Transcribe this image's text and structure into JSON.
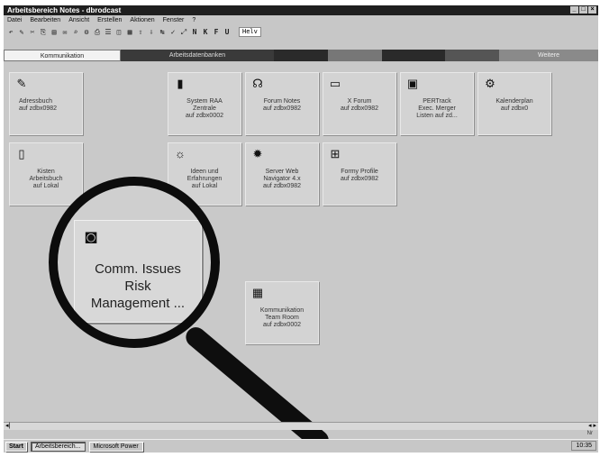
{
  "window": {
    "title": "Arbeitsbereich Notes - dbrodcast",
    "controls": [
      "_",
      "□",
      "×"
    ]
  },
  "menu": [
    "Datei",
    "Bearbeiten",
    "Ansicht",
    "Erstellen",
    "Aktionen",
    "Fenster",
    "?"
  ],
  "toolbar": {
    "icons": [
      "↶",
      "✎",
      "✂",
      "⎘",
      "▤",
      "✉",
      "⌕",
      "⚙",
      "⎙",
      "☰",
      "◫",
      "▦",
      "⇧",
      "⇩",
      "↹",
      "✓",
      "⤢"
    ],
    "format": [
      "N",
      "K",
      "F",
      "U"
    ],
    "font_value": "Helv"
  },
  "tabs": [
    "Kommunikation",
    "Arbeitsdatenbanken",
    "",
    "",
    "",
    "",
    "Weitere"
  ],
  "tiles": [
    {
      "icon": "✎",
      "label": "Adressbuch\nauf zdbx0982"
    },
    {
      "icon": "▮",
      "label": "System RAA\nZentrale\nauf zdbx0002"
    },
    {
      "icon": "☊",
      "label": "Forum Notes\nauf zdbx0982"
    },
    {
      "icon": "▭",
      "label": "X Forum\nauf zdbx0982"
    },
    {
      "icon": "▣",
      "label": "PERTrack\nExec. Merger\nListen auf zd..."
    },
    {
      "icon": "⚙",
      "label": "Kalenderplan\nauf zdbx0"
    },
    {
      "icon": "▯",
      "label": "Kisten\nArbeitsbuch\nauf Lokal"
    },
    {
      "icon": "☼",
      "label": "Ideen und\nErfahrungen\nauf Lokal"
    },
    {
      "icon": "✹",
      "label": "Server Web\nNavigator 4.x\nauf zdbx0982"
    },
    {
      "icon": "⊞",
      "label": "Formy Profile\nauf zdbx0982"
    },
    {
      "icon": "▦",
      "label": "Kommunikation\nTeam Room\nauf zdbx0002"
    }
  ],
  "magnified_tile": {
    "icon": "◙",
    "label": "Comm. Issues\nRisk\nManagement ..."
  },
  "statusbar": {
    "left": "◂|",
    "right": "◂ ▸",
    "time_indicator": "Nr"
  },
  "taskbar": {
    "start": "Start",
    "tasks": [
      "Arbeitsbereich...",
      "Microsoft Power"
    ],
    "tray_time": "10:35"
  }
}
